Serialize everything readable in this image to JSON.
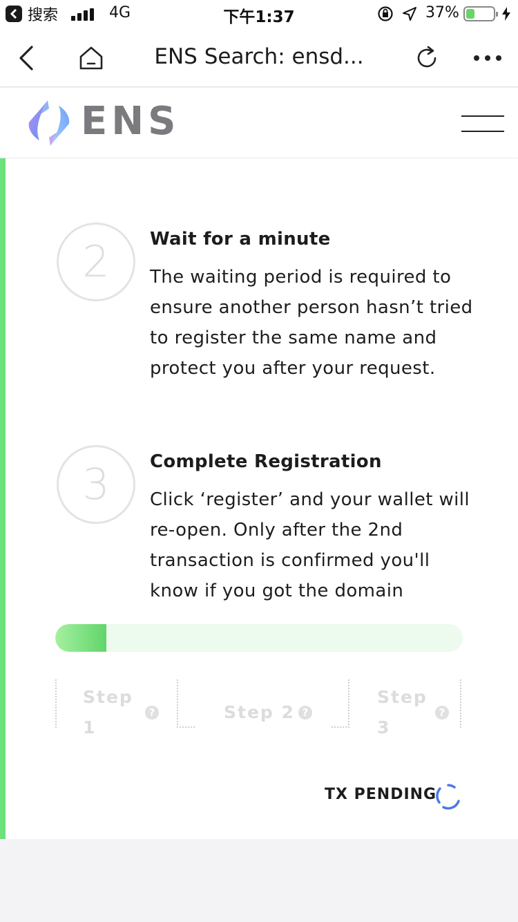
{
  "status_bar": {
    "app_name": "搜索",
    "network": "4G",
    "time": "下午1:37",
    "battery_percent": "37%",
    "battery_level": 0.37
  },
  "browser": {
    "title": "ENS Search: ensd..."
  },
  "header": {
    "wordmark": "ENS",
    "logo_colors": [
      "#5d93f5",
      "#b58ef0"
    ]
  },
  "steps": [
    {
      "number": "2",
      "title": "Wait for a minute",
      "description": "The waiting period is required to ensure another person hasn’t tried to register the same name and protect you after your request."
    },
    {
      "number": "3",
      "title": "Complete Registration",
      "description": "Click ‘register’ and your wallet will re-open. Only after the 2nd transaction is confirmed you'll know if you got the domain"
    }
  ],
  "progress": {
    "value": 0.125,
    "step_labels": [
      "Step 1",
      "Step 2",
      "Step 3"
    ],
    "help_glyph": "?"
  },
  "tx_status": "TX PENDING",
  "colors": {
    "accent_green": "#6ee07c",
    "spinner_blue": "#4a78e8"
  }
}
